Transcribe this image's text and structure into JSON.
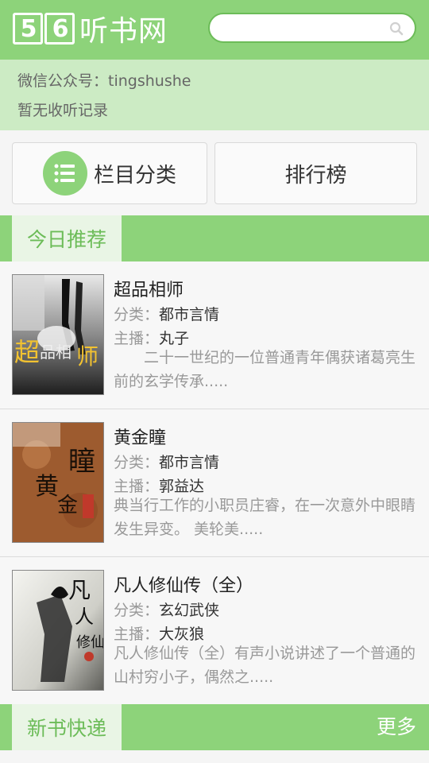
{
  "header": {
    "logo_digits": [
      "5",
      "6"
    ],
    "logo_text": "听书网",
    "search": {
      "placeholder": "",
      "value": ""
    }
  },
  "notice": {
    "wechat": "微信公众号：tingshushe",
    "history": "暂无收听记录"
  },
  "nav": {
    "category_label": "栏目分类",
    "ranking_label": "排行榜"
  },
  "sections": {
    "today": {
      "title": "今日推荐"
    },
    "new": {
      "title": "新书快递",
      "more": "更多"
    }
  },
  "books": [
    {
      "title": "超品相师",
      "category_label": "分类：",
      "category": "都市言情",
      "host_label": "主播：",
      "host": "丸子",
      "description": "　　二十一世纪的一位普通青年偶获诸葛亮生前的玄学传承.....",
      "cover_text": "超品相师"
    },
    {
      "title": "黄金瞳",
      "category_label": "分类：",
      "category": "都市言情",
      "host_label": "主播：",
      "host": "郭益达",
      "description": "典当行工作的小职员庄睿，在一次意外中眼睛发生异变。 美轮美.....",
      "cover_text": "黄金瞳"
    },
    {
      "title": "凡人修仙传（全）",
      "category_label": "分类：",
      "category": "玄幻武侠",
      "host_label": "主播：",
      "host": "大灰狼",
      "description": "凡人修仙传（全）有声小说讲述了一个普通的山村穷小子，偶然之.....",
      "cover_text": "凡人修仙传"
    }
  ],
  "colors": {
    "accent": "#8dd37a",
    "accent_dark": "#6cbc58",
    "notice_bg": "#ccebc4"
  }
}
